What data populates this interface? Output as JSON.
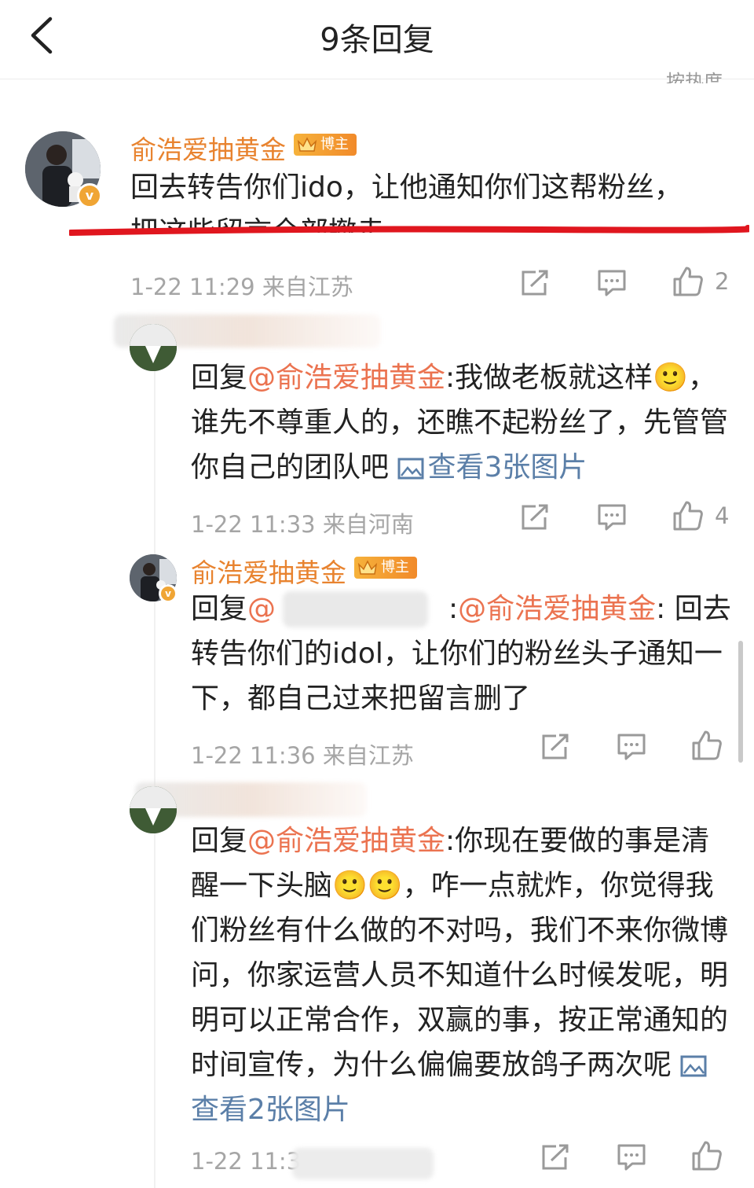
{
  "header": {
    "title": "9条回复",
    "sort_label": "按热度"
  },
  "comments": [
    {
      "username": "俞浩爱抽黄金",
      "badge": "博主",
      "text_a": "回去转告你们ido，让他通知你们这帮粉丝，",
      "text_b": "把这些留言全部撤走",
      "meta": "1-22 11:29  来自江苏",
      "likes": "2"
    },
    {
      "text_prefix": "回复",
      "mention": "@俞浩爱抽黄金",
      "text_body": ":我做老板就这样🙂，谁先不尊重人的，还瞧不起粉丝了，先管管你自己的团队吧 ",
      "image_link": "查看3张图片",
      "meta": "1-22 11:33  来自河南",
      "likes": "4"
    },
    {
      "username": "俞浩爱抽黄金",
      "badge": "博主",
      "text_prefix": "回复",
      "mention_a": "@",
      "text_mid": ":",
      "mention_b": "@俞浩爱抽黄金",
      "text_body": ": 回去转告你们的idol，让你们的粉丝头子通知一下，都自己过来把留言删了",
      "meta": "1-22 11:36  来自江苏"
    },
    {
      "text_prefix": "回复",
      "mention": "@俞浩爱抽黄金",
      "text_body": ":你现在要做的事是清醒一下头脑🙂🙂，咋一点就炸，你觉得我们粉丝有什么做的不对吗，我们不来你微博问，你家运营人员不知道什么时候发呢，明明可以正常合作，双赢的事，按正常通知的时间宣传，为什么偏偏要放鸽子两次呢 ",
      "image_link": "查看2张图片",
      "meta": "1-22 11:3"
    }
  ],
  "colors": {
    "username": "#e8832f",
    "mention": "#eb7350",
    "link": "#5b7fa8",
    "meta": "#a5a5a5",
    "annotation_line": "#e0161e"
  },
  "icons": [
    "back-icon",
    "share-icon",
    "comment-icon",
    "like-icon",
    "image-icon",
    "crown-icon",
    "verified-icon"
  ]
}
